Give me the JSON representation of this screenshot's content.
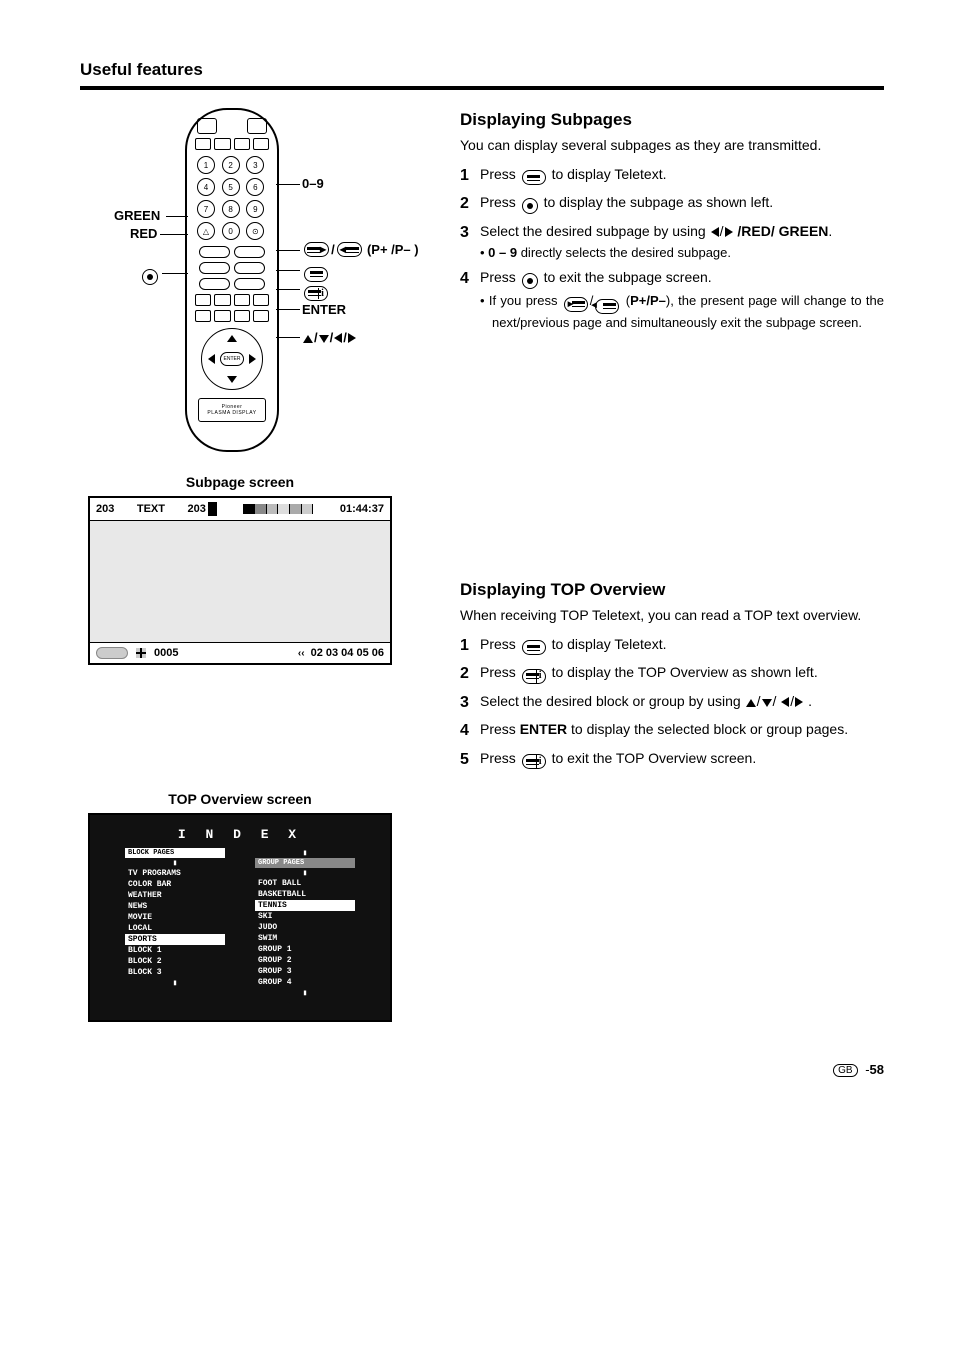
{
  "header": {
    "title": "Useful features"
  },
  "remote_labels": {
    "zero_nine": "0–9",
    "green": "GREEN",
    "red": "RED",
    "play_rew": "(P+ /P– )",
    "menu_icon": "",
    "circle": "",
    "ei_icon": "",
    "enter": "ENTER",
    "arrows": "▲/▼/◀/▶",
    "brand": "Pioneer",
    "brand_sub": "PLASMA DISPLAY"
  },
  "subpage_caption": "Subpage screen",
  "subpage_screen": {
    "num1": "203",
    "text": "TEXT",
    "num2": "203",
    "time": "01:44:37",
    "bottom_code": "0005",
    "bottom_pages": "02 03 04 05 06"
  },
  "top_caption": "TOP Overview screen",
  "top_screen": {
    "title": "I N D E X",
    "block_header": "BLOCK PAGES",
    "group_header": "GROUP PAGES",
    "block_items": [
      "TV PROGRAMS",
      "COLOR BAR",
      "WEATHER",
      "NEWS",
      "MOVIE",
      "LOCAL",
      "SPORTS",
      "BLOCK 1",
      "BLOCK 2",
      "BLOCK 3"
    ],
    "group_items": [
      "FOOT BALL",
      "BASKETBALL",
      "TENNIS",
      "SKI",
      "JUDO",
      "SWIM",
      "GROUP 1",
      "GROUP 2",
      "GROUP 3",
      "GROUP 4"
    ]
  },
  "section1": {
    "title": "Displaying Subpages",
    "intro": "You can display several subpages as they are transmitted.",
    "step1_a": "Press ",
    "step1_b": " to display Teletext.",
    "step2_a": "Press ",
    "step2_b": " to display the subpage as shown left.",
    "step3_a": "Select the desired subpage by using ",
    "step3_red": "/RED/",
    "step3_green": "GREEN",
    "step3_sub_bold": "0 – 9",
    "step3_sub_rest": " directly selects the desired subpage.",
    "step4_a": "Press ",
    "step4_b": " to exit the subpage screen.",
    "step4_sub_a": "If you press ",
    "step4_sub_mid": " (",
    "step4_sub_pp": "P+/P–",
    "step4_sub_b": "), the present page will change to the next/previous page and simultaneously exit the subpage screen."
  },
  "section2": {
    "title": "Displaying TOP Overview",
    "intro": "When receiving TOP Teletext, you can read a TOP text overview.",
    "step1_a": "Press ",
    "step1_b": " to display Teletext.",
    "step2_a": "Press ",
    "step2_b": " to display the TOP Overview as shown left.",
    "step3_a": "Select the desired block or group by using ",
    "step3_b": ".",
    "step4_a": "Press ",
    "step4_enter": "ENTER",
    "step4_b": " to display the selected block or group pages.",
    "step5_a": "Press ",
    "step5_b": " to exit the TOP Overview screen."
  },
  "footer": {
    "gb": "GB",
    "dash": " -",
    "page": "58"
  }
}
